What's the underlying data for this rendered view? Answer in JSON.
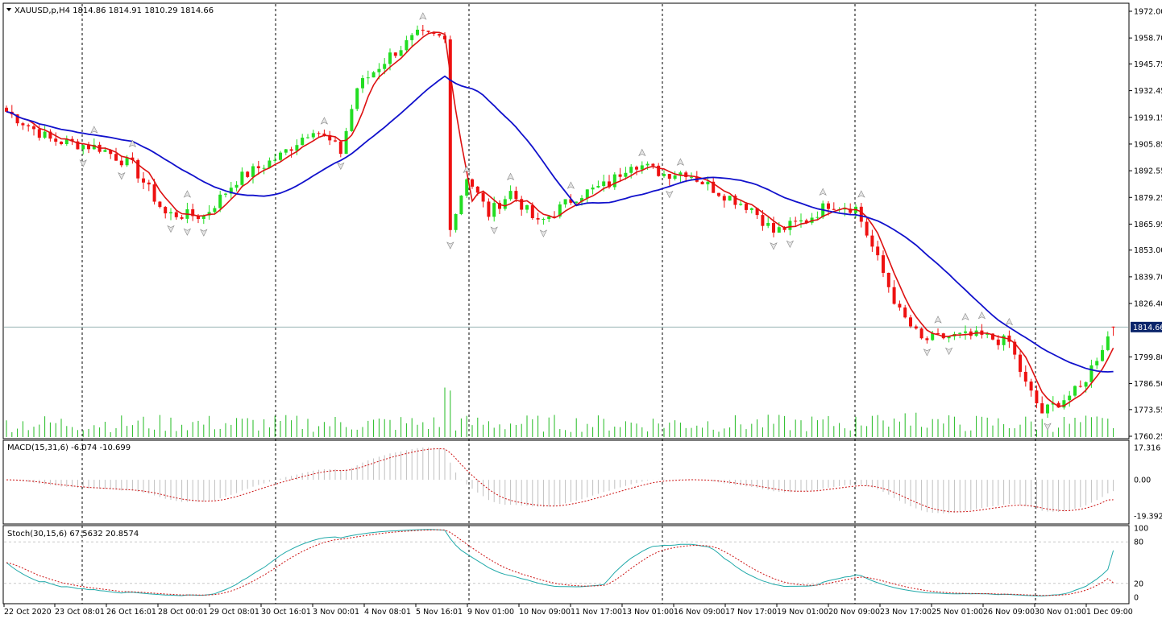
{
  "header": {
    "symbol_info": "XAUUSD,p,H4  1814.86 1814.91 1810.29 1814.66",
    "macd_info": "MACD(15,31,6) -6.074 -10.699",
    "stoch_info": "Stoch(30,15,6) 67.5632 20.8574"
  },
  "price_badge": "1814.66",
  "colors": {
    "bull": "#22dd22",
    "bear": "#ee1111",
    "ma_fast": "#dd1111",
    "ma_slow": "#1111cc",
    "volume": "#22bb22",
    "macd_hist": "#c0c0c0",
    "macd_signal": "#cc1111",
    "stoch_main": "#22aaaa",
    "stoch_signal": "#cc1111",
    "separator": "#000000",
    "badge_bg": "#0a246a"
  },
  "chart_data": {
    "type": "candlestick",
    "symbol": "XAUUSD",
    "timeframe": "H4",
    "price_axis_ticks": [
      "1972.00",
      "1958.70",
      "1945.75",
      "1932.45",
      "1919.15",
      "1905.85",
      "1892.55",
      "1879.25",
      "1865.95",
      "1853.00",
      "1839.70",
      "1826.40",
      "1799.80",
      "1786.50",
      "1773.55",
      "1760.25"
    ],
    "ylim": [
      1760.25,
      1972.0
    ],
    "time_axis_labels": [
      "22 Oct 2020",
      "23 Oct 08:01",
      "26 Oct 16:01",
      "28 Oct 00:01",
      "29 Oct 08:01",
      "30 Oct 16:01",
      "3 Nov 00:01",
      "4 Nov 08:01",
      "5 Nov 16:01",
      "9 Nov 01:00",
      "10 Nov 09:00",
      "11 Nov 17:00",
      "13 Nov 01:00",
      "16 Nov 09:00",
      "17 Nov 17:00",
      "19 Nov 01:00",
      "20 Nov 09:00",
      "23 Nov 17:00",
      "25 Nov 01:00",
      "26 Nov 09:00",
      "30 Nov 01:00",
      "1 Dec 09:00"
    ],
    "anchors": [
      {
        "bar": 0,
        "price": 1922
      },
      {
        "bar": 8,
        "price": 1908
      },
      {
        "bar": 17,
        "price": 1904
      },
      {
        "bar": 23,
        "price": 1895
      },
      {
        "bar": 29,
        "price": 1871
      },
      {
        "bar": 36,
        "price": 1870
      },
      {
        "bar": 42,
        "price": 1888
      },
      {
        "bar": 50,
        "price": 1900
      },
      {
        "bar": 56,
        "price": 1914
      },
      {
        "bar": 61,
        "price": 1902
      },
      {
        "bar": 64,
        "price": 1934
      },
      {
        "bar": 70,
        "price": 1950
      },
      {
        "bar": 75,
        "price": 1960
      },
      {
        "bar": 79,
        "price": 1959
      },
      {
        "bar": 81,
        "price": 1863
      },
      {
        "bar": 84,
        "price": 1890
      },
      {
        "bar": 88,
        "price": 1871
      },
      {
        "bar": 92,
        "price": 1882
      },
      {
        "bar": 97,
        "price": 1866
      },
      {
        "bar": 104,
        "price": 1880
      },
      {
        "bar": 110,
        "price": 1886
      },
      {
        "bar": 114,
        "price": 1897
      },
      {
        "bar": 120,
        "price": 1891
      },
      {
        "bar": 124,
        "price": 1892
      },
      {
        "bar": 130,
        "price": 1882
      },
      {
        "bar": 136,
        "price": 1874
      },
      {
        "bar": 140,
        "price": 1862
      },
      {
        "bar": 146,
        "price": 1868
      },
      {
        "bar": 150,
        "price": 1876
      },
      {
        "bar": 155,
        "price": 1874
      },
      {
        "bar": 159,
        "price": 1848
      },
      {
        "bar": 163,
        "price": 1822
      },
      {
        "bar": 167,
        "price": 1808
      },
      {
        "bar": 172,
        "price": 1810
      },
      {
        "bar": 178,
        "price": 1810
      },
      {
        "bar": 183,
        "price": 1807
      },
      {
        "bar": 186,
        "price": 1786
      },
      {
        "bar": 189,
        "price": 1772
      },
      {
        "bar": 193,
        "price": 1779
      },
      {
        "bar": 196,
        "price": 1784
      },
      {
        "bar": 200,
        "price": 1805
      },
      {
        "bar": 202,
        "price": 1814.66
      }
    ],
    "last_bar": {
      "open": 1814.86,
      "high": 1814.91,
      "low": 1810.29,
      "close": 1814.66
    },
    "moving_averages": [
      {
        "name": "MA fast",
        "color": "#dd1111"
      },
      {
        "name": "MA slow",
        "color": "#1111cc"
      }
    ],
    "indicators": {
      "macd": {
        "fast": 15,
        "slow": 31,
        "signal": 6,
        "main": -6.074,
        "signal_value": -10.699,
        "axis_ticks": [
          "17.316",
          "0.00",
          "-19.392"
        ],
        "ylim": [
          -19.392,
          17.316
        ]
      },
      "stochastic": {
        "k": 30,
        "d": 15,
        "slowing": 6,
        "main": 67.5632,
        "signal": 20.8574,
        "axis_ticks": [
          "100",
          "80",
          "20",
          "0"
        ],
        "levels": [
          80,
          20
        ],
        "ylim": [
          0,
          100
        ]
      }
    }
  }
}
